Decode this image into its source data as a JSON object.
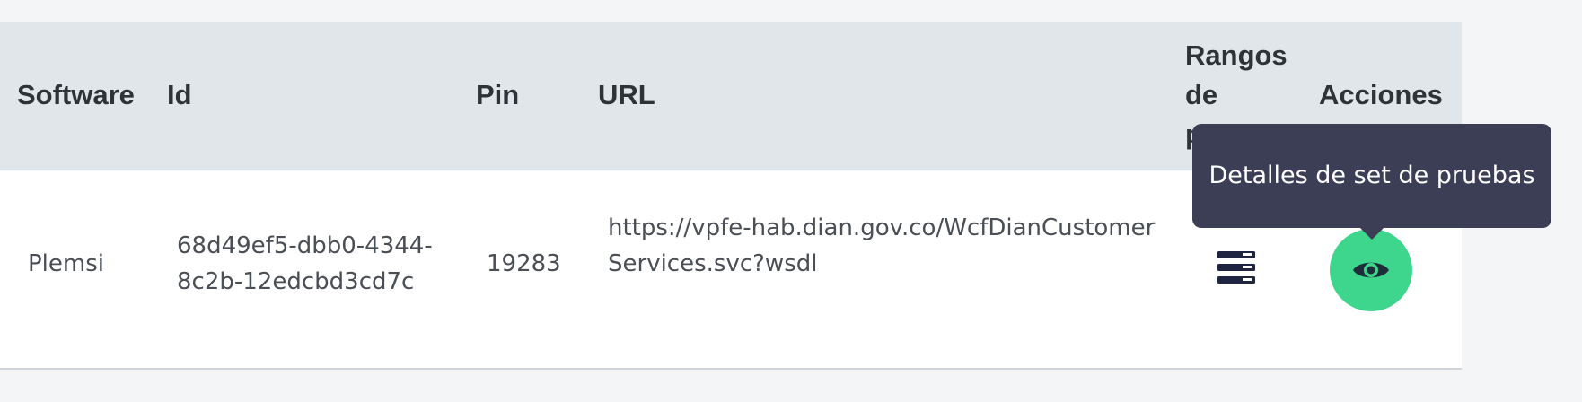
{
  "table": {
    "headers": {
      "software": "Software",
      "id": "Id",
      "pin": "Pin",
      "url": "URL",
      "rangos": "Rangos de prueba",
      "acciones": "Acciones"
    },
    "rows": [
      {
        "software": "Plemsi",
        "id": "68d49ef5-dbb0-4344-8c2b-12edcbd3cd7c",
        "pin": "19283",
        "url": "https://vpfe-hab.dian.gov.co/WcfDianCustomerServices.svc?wsdl"
      }
    ]
  },
  "tooltip": {
    "text": "Detalles de set de pruebas"
  },
  "icons": {
    "rangos": "server-list-icon",
    "view": "eye-icon"
  },
  "colors": {
    "header_bg": "#e1e6ea",
    "view_button": "#3dd68c",
    "tooltip_bg": "#3b3e55"
  }
}
